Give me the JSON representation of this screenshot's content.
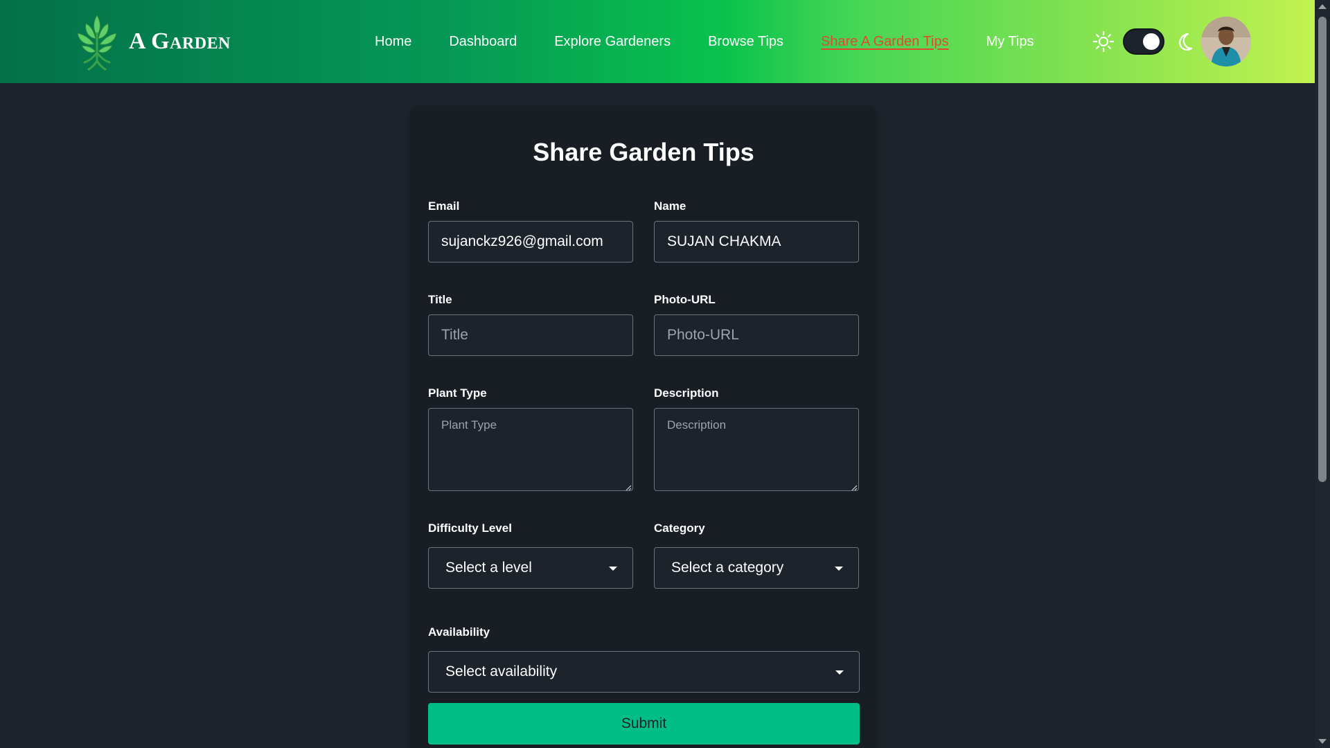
{
  "brand": {
    "name": "A Garden",
    "logo_icon": "tree-leaf-logo-icon"
  },
  "nav": {
    "links": [
      {
        "label": "Home",
        "active": false
      },
      {
        "label": "Dashboard",
        "active": false
      },
      {
        "label": "Explore Gardeners",
        "active": false
      },
      {
        "label": "Browse Tips",
        "active": false
      },
      {
        "label": "Share A Garden Tips",
        "active": true
      },
      {
        "label": "My Tips",
        "active": false
      }
    ],
    "active_color": "#e04b2d"
  },
  "theme": {
    "light_icon": "sun-icon",
    "dark_icon": "moon-icon",
    "dark_mode_on": true
  },
  "form": {
    "title": "Share Garden Tips",
    "email": {
      "label": "Email",
      "value": "sujanckz926@gmail.com"
    },
    "name": {
      "label": "Name",
      "value": "SUJAN CHAKMA"
    },
    "title_field": {
      "label": "Title",
      "placeholder": "Title",
      "value": ""
    },
    "photo_url": {
      "label": "Photo-URL",
      "placeholder": "Photo-URL",
      "value": ""
    },
    "plant_type": {
      "label": "Plant Type",
      "placeholder": "Plant Type",
      "value": ""
    },
    "description": {
      "label": "Description",
      "placeholder": "Description",
      "value": ""
    },
    "difficulty": {
      "label": "Difficulty Level",
      "selected": "Select a level"
    },
    "category": {
      "label": "Category",
      "selected": "Select a category"
    },
    "availability": {
      "label": "Availability",
      "selected": "Select availability"
    },
    "submit_label": "Submit"
  },
  "colors": {
    "submit_bg": "#00be86",
    "page_bg": "#1d232a",
    "card_bg": "#191e24"
  }
}
